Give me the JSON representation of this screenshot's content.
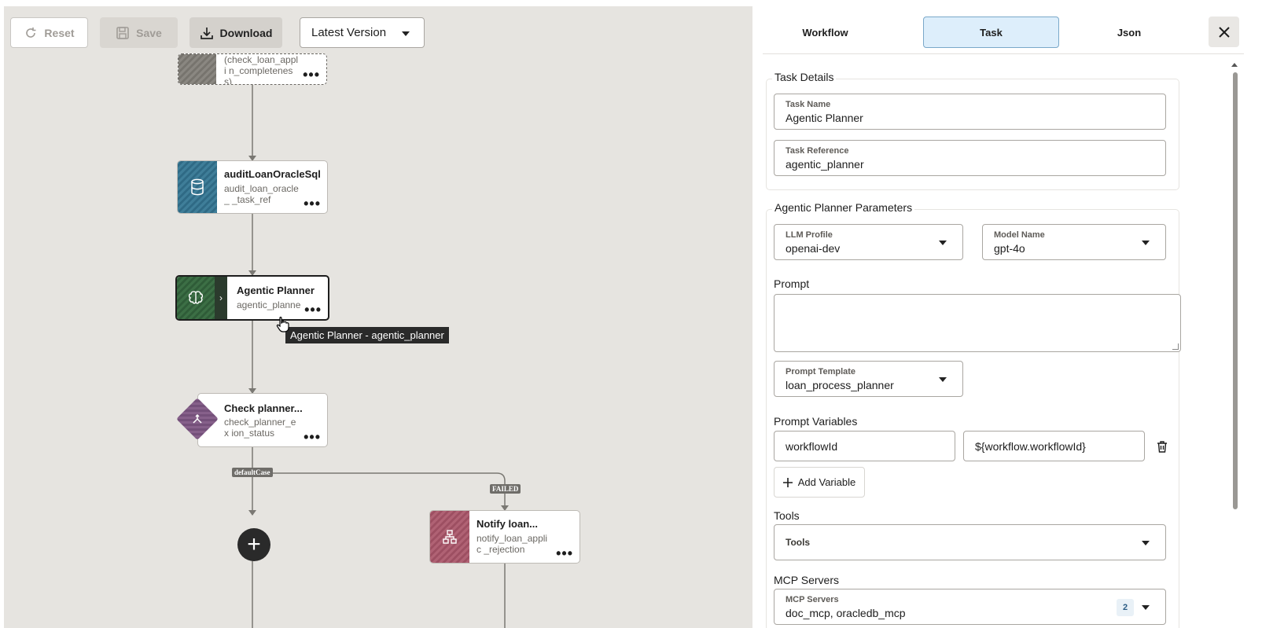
{
  "toolbar": {
    "reset_label": "Reset",
    "save_label": "Save",
    "download_label": "Download",
    "version_select": "Latest Version"
  },
  "canvas": {
    "nodes": [
      {
        "title": "",
        "ref": "(check_loan_appli n_completeness)",
        "icon": "task-icon",
        "color": "#8a8781"
      },
      {
        "title": "auditLoanOracleSql",
        "ref": "audit_loan_oracle_ _task_ref",
        "icon": "database-icon",
        "color": "#3f7e99"
      },
      {
        "title": "Agentic Planner",
        "ref": "agentic_planne",
        "icon": "brain-icon",
        "color": "#3c6f45"
      },
      {
        "title": "Check planner...",
        "ref": "check_planner_ex ion_status",
        "icon": "switch-icon",
        "color": "#86608a"
      },
      {
        "title": "Notify loan...",
        "ref": "notify_loan_applic _rejection",
        "icon": "fork-icon",
        "color": "#b06274"
      }
    ],
    "edge_labels": {
      "default_case": "defaultCase",
      "failed": "FAILED"
    },
    "node_menu": "•••",
    "add_node": "+",
    "tooltip": "Agentic Planner - agentic_planner"
  },
  "panel": {
    "tabs": {
      "workflow": "Workflow",
      "task": "Task",
      "json": "Json"
    },
    "task_details": {
      "legend": "Task Details",
      "task_name_label": "Task Name",
      "task_name_value": "Agentic Planner",
      "task_reference_label": "Task Reference",
      "task_reference_value": "agentic_planner"
    },
    "planner_params": {
      "legend": "Agentic Planner Parameters",
      "llm_profile_label": "LLM Profile",
      "llm_profile_value": "openai-dev",
      "model_name_label": "Model Name",
      "model_name_value": "gpt-4o",
      "prompt_label": "Prompt",
      "prompt_value": "",
      "prompt_template_label": "Prompt Template",
      "prompt_template_value": "loan_process_planner",
      "prompt_variables_label": "Prompt Variables",
      "variable_key": "workflowId",
      "variable_value": "${workflow.workflowId}",
      "add_variable_label": "Add Variable",
      "tools_label": "Tools",
      "tools_placeholder": "Tools",
      "mcp_servers_label": "MCP Servers",
      "mcp_field_label": "MCP Servers",
      "mcp_value": "doc_mcp, oracledb_mcp",
      "mcp_count": "2"
    }
  },
  "colors": {
    "accent_tab": "#ddeefb",
    "canvas_bg": "#e6e4e0",
    "tooltip_bg": "#2a2a2a"
  }
}
